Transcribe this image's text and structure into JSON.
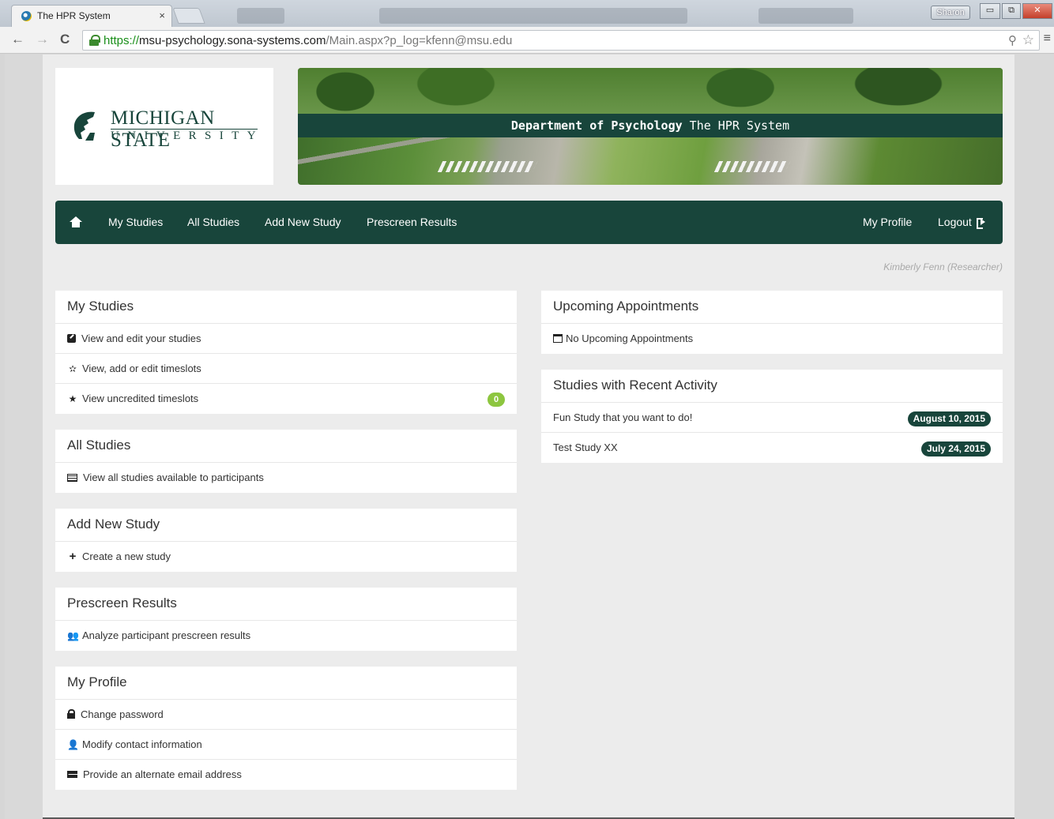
{
  "browser": {
    "tab_title": "The HPR System",
    "tab_close": "×",
    "url_scheme": "https://",
    "url_host": "msu-psychology.sona-systems.com",
    "url_path": "/Main.aspx?p_log=kfenn@msu.edu",
    "user_badge": "Sharon",
    "back_icon": "←",
    "forward_icon": "→",
    "reload_icon": "C",
    "ext_icon": "⚲",
    "star_icon": "☆",
    "menu_icon": "≡",
    "min_icon": "▭",
    "restore_icon": "⧉",
    "close_icon": "✕"
  },
  "logo": {
    "line1": "MICHIGAN STATE",
    "line2": "UNIVERSITY"
  },
  "banner": {
    "dept": "Department of Psychology",
    "system": "The HPR System"
  },
  "nav": {
    "items": [
      "My Studies",
      "All Studies",
      "Add New Study",
      "Prescreen Results"
    ],
    "my_profile": "My Profile",
    "logout": "Logout"
  },
  "user": {
    "display": "Kimberly Fenn (Researcher)"
  },
  "panels": {
    "my_studies": {
      "title": "My Studies",
      "items": [
        "View and edit your studies",
        "View, add or edit timeslots",
        "View uncredited timeslots"
      ],
      "uncredited_count": "0"
    },
    "all_studies": {
      "title": "All Studies",
      "items": [
        "View all studies available to participants"
      ]
    },
    "add_new_study": {
      "title": "Add New Study",
      "items": [
        "Create a new study"
      ]
    },
    "prescreen": {
      "title": "Prescreen Results",
      "items": [
        "Analyze participant prescreen results"
      ]
    },
    "my_profile": {
      "title": "My Profile",
      "items": [
        "Change password",
        "Modify contact information",
        "Provide an alternate email address"
      ]
    },
    "upcoming": {
      "title": "Upcoming Appointments",
      "empty": "No Upcoming Appointments"
    },
    "recent": {
      "title": "Studies with Recent Activity",
      "rows": [
        {
          "name": "Fun Study that you want to do!",
          "date": "August 10, 2015"
        },
        {
          "name": "Test Study XX",
          "date": "July 24, 2015"
        }
      ]
    }
  },
  "colors": {
    "msu_green": "#18453b",
    "badge_green": "#8dc63f"
  }
}
